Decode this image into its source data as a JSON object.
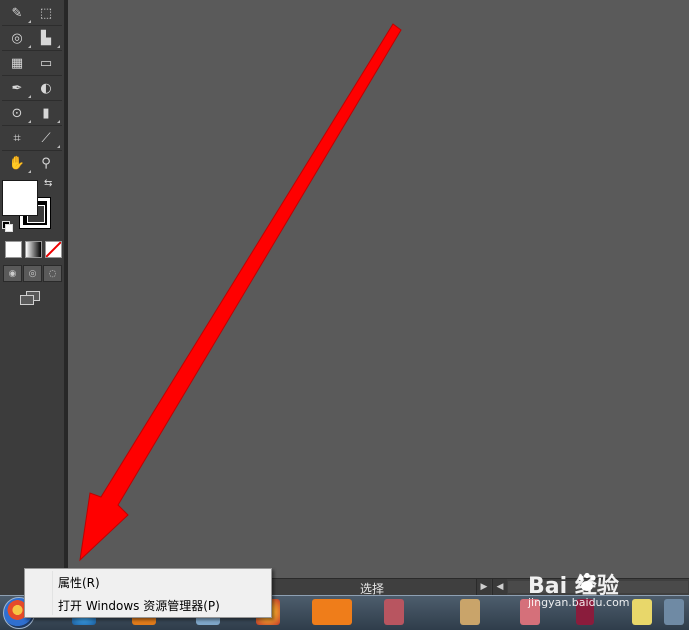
{
  "toolbar": {
    "tools": [
      {
        "icon": "warp-tool-icon",
        "glyph": "✎"
      },
      {
        "icon": "free-transform-icon",
        "glyph": "⬚"
      },
      {
        "icon": "shape-builder-icon",
        "glyph": "◎"
      },
      {
        "icon": "graph-tool-icon",
        "glyph": "▙"
      },
      {
        "icon": "mesh-tool-icon",
        "glyph": "▦"
      },
      {
        "icon": "gradient-tool-icon",
        "glyph": "▭"
      },
      {
        "icon": "eyedropper-icon",
        "glyph": "✒"
      },
      {
        "icon": "blend-tool-icon",
        "glyph": "◐"
      },
      {
        "icon": "symbol-sprayer-icon",
        "glyph": "⊙"
      },
      {
        "icon": "column-graph-icon",
        "glyph": "▮"
      },
      {
        "icon": "artboard-tool-icon",
        "glyph": "⌗"
      },
      {
        "icon": "slice-tool-icon",
        "glyph": "⟋"
      },
      {
        "icon": "hand-tool-icon",
        "glyph": "✋"
      },
      {
        "icon": "zoom-tool-icon",
        "glyph": "⚲"
      }
    ],
    "fill_color": "#ffffff",
    "stroke_color": "#000000"
  },
  "status_bar": {
    "tool_label": "选择"
  },
  "context_menu": {
    "items": [
      "属性(R)",
      "打开 Windows 资源管理器(P)"
    ]
  },
  "watermark": {
    "logo": "Bai  经验",
    "site": "jingyan.baidu.com"
  },
  "colors": {
    "arrow": "#ff0000",
    "canvas": "#5a5a5a",
    "toolbar": "#3c3c3c"
  }
}
